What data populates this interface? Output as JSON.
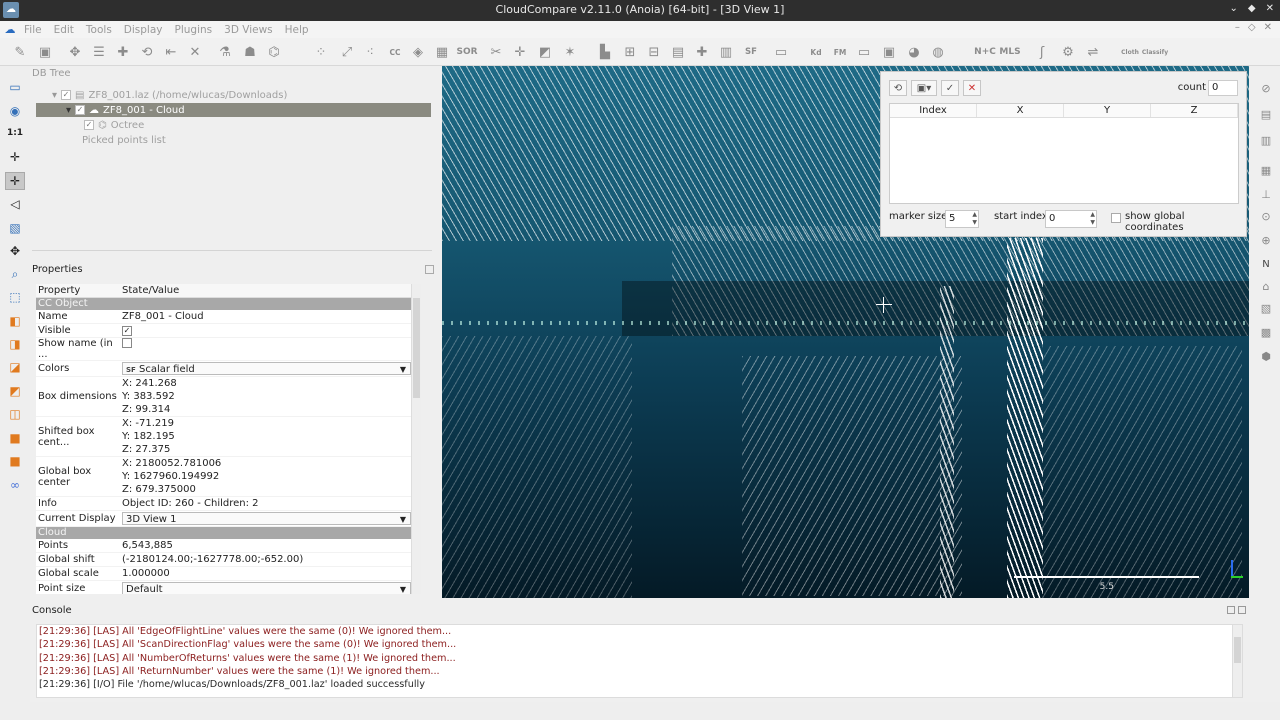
{
  "window": {
    "title": "CloudCompare v2.11.0 (Anoia) [64-bit] - [3D View 1]",
    "controls": [
      "⌄",
      "◆",
      "✕"
    ]
  },
  "menu": {
    "items": [
      "File",
      "Edit",
      "Tools",
      "Display",
      "Plugins",
      "3D Views",
      "Help"
    ],
    "right_buttons": [
      "–",
      "◇",
      "✕"
    ]
  },
  "toolbar": {
    "icons": [
      "open-icon",
      "save-icon",
      "clone-icon",
      "list-icon",
      "merge-icon",
      "subsample-icon",
      "segment-icon",
      "translate-icon",
      "delete-icon",
      "sample-icon",
      "normals-icon",
      "octree-icon",
      "sor-icon",
      "noise-icon",
      "crop-icon",
      "cc-icon",
      "color-icon",
      "checker-icon",
      "sor-text",
      "crop-tool-icon",
      "plane-icon",
      "crosshair-icon",
      "histogram-icon",
      "compute-icon",
      "rasterize-icon",
      "add-icon",
      "bar-icon",
      "sf-icon",
      "kd-icon",
      "fm-icon",
      "hidden-icon",
      "sphere-icon",
      "grid-icon",
      "n-c-icon",
      "mls-icon",
      "curve-icon",
      "settings-icon",
      "compare-icon",
      "classify-icon",
      "tools-icon"
    ],
    "labels": {
      "sor": "SOR",
      "sf": "SF",
      "kd": "Kd",
      "fm": "FM",
      "mls": "MLS",
      "nc": "N+C",
      "cloth": "Cloth",
      "classify": "Classify"
    }
  },
  "db_tree": {
    "title": "DB Tree",
    "items": [
      {
        "label": "ZF8_001.laz (/home/wlucas/Downloads)",
        "checked": true
      },
      {
        "label": "ZF8_001 - Cloud",
        "checked": true,
        "selected": true
      },
      {
        "label": "Octree",
        "checked": true
      },
      {
        "label": "Picked points list",
        "checked": false
      }
    ]
  },
  "properties": {
    "title": "Properties",
    "header": {
      "property": "Property",
      "value": "State/Value"
    },
    "section_ccobject": "CC Object",
    "name": {
      "key": "Name",
      "value": "ZF8_001 - Cloud"
    },
    "visible": {
      "key": "Visible",
      "value": "✓"
    },
    "show_name": {
      "key": "Show name (in ...",
      "value": ""
    },
    "colors": {
      "key": "Colors",
      "value": "Scalar field",
      "badge": "SF"
    },
    "box_dimensions": {
      "key": "Box dimensions",
      "x": "X: 241.268",
      "y": "Y: 383.592",
      "z": "Z: 99.314"
    },
    "shifted_center": {
      "key": "Shifted box cent...",
      "x": "X: -71.219",
      "y": "Y: 182.195",
      "z": "Z: 27.375"
    },
    "global_center": {
      "key": "Global box center",
      "x": "X: 2180052.781006",
      "y": "Y: 1627960.194992",
      "z": "Z: 679.375000"
    },
    "info": {
      "key": "Info",
      "value": "Object ID: 260 - Children: 2"
    },
    "current_display": {
      "key": "Current Display",
      "value": "3D View 1"
    },
    "section_cloud": "Cloud",
    "points": {
      "key": "Points",
      "value": "6,543,885"
    },
    "global_shift": {
      "key": "Global shift",
      "value": "(-2180124.00;-1627778.00;-652.00)"
    },
    "global_scale": {
      "key": "Global scale",
      "value": "1.000000"
    },
    "point_size": {
      "key": "Point size",
      "value": "Default"
    }
  },
  "picker": {
    "count_label": "count",
    "count_value": "0",
    "columns": [
      "Index",
      "X",
      "Y",
      "Z"
    ],
    "marker_size_label": "marker size",
    "marker_size_value": "5",
    "start_index_label": "start index",
    "start_index_value": "0",
    "global_coords_label": "show global coordinates"
  },
  "view3d": {
    "scale_label": "5.5"
  },
  "console": {
    "title": "Console",
    "lines": [
      {
        "text": "[21:29:36] [LAS] All 'EdgeOfFlightLine' values were the same (0)! We ignored them...",
        "level": "warn"
      },
      {
        "text": "[21:29:36] [LAS] All 'ScanDirectionFlag' values were the same (0)! We ignored them...",
        "level": "warn"
      },
      {
        "text": "[21:29:36] [LAS] All 'NumberOfReturns' values were the same (1)! We ignored them...",
        "level": "warn"
      },
      {
        "text": "[21:29:36] [LAS] All 'ReturnNumber' values were the same (1)! We ignored them...",
        "level": "warn"
      },
      {
        "text": "[21:29:36] [I/O] File '/home/wlucas/Downloads/ZF8_001.laz' loaded successfully",
        "level": "ok"
      }
    ]
  },
  "left_toolbar": {
    "labels": {
      "ratio": "1:1",
      "orient": "N"
    }
  }
}
